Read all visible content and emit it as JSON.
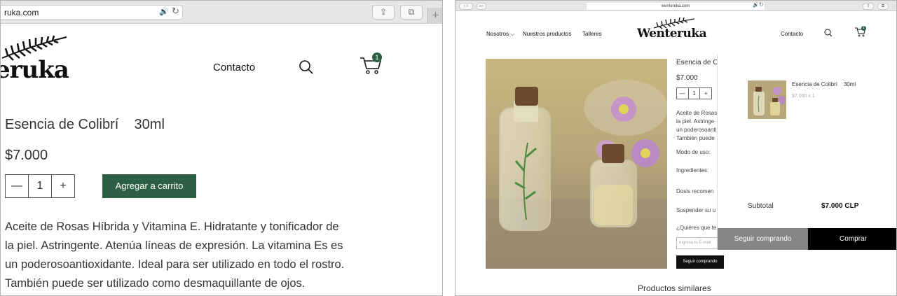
{
  "left": {
    "url": "ruka.com",
    "logo": "eruka",
    "nav": {
      "contact": "Contacto",
      "cart_count": "1"
    },
    "product": {
      "name": "Esencia de Colibrí    30ml",
      "price": "$7.000",
      "qty_minus": "—",
      "qty": "1",
      "qty_plus": "+",
      "add_to_cart": "Agregar a carrito",
      "description": [
        "Aceite de Rosas Híbrida y Vitamina E. Hidratante y tonificador de",
        "la piel. Astringente. Atenúa líneas de expresión. La vitamina Es es",
        "un poderosoantioxidante. Ideal para ser utilizado en todo el rostro.",
        "También puede ser utilizado como desmaquillante de ojos."
      ]
    }
  },
  "right": {
    "url": "wenteruka.com",
    "nav": {
      "nosotros": "Nosotros",
      "productos": "Nuestros productos",
      "talleres": "Talleres",
      "contact": "Contacto",
      "cart_count": "1"
    },
    "logo": "Wenteruka",
    "product": {
      "name": "Esencia de C",
      "price": "$7.000",
      "qty_minus": "—",
      "qty": "1",
      "qty_plus": "+",
      "desc_lines": [
        "Aceite de Rosas",
        "la piel. Astringe",
        "un poderosoanti",
        "También puede"
      ],
      "modo": "Modo de uso:",
      "ingredientes": "Ingredientes:",
      "dosis": "Dosis recomen",
      "suspender": "Suspender su u",
      "quieres": "¿Quiéres que te",
      "email_placeholder": "Ingresa tu E-mail",
      "subscribe": "Seguir comprando"
    },
    "similar": "Productos similares",
    "cart": {
      "item_name": "Esencia de Colibrí    30ml",
      "item_qty": "$7.000 x 1",
      "subtotal_label": "Subtotal",
      "subtotal_value": "$7.000 CLP",
      "continue": "Seguir comprando",
      "checkout": "Comprar"
    }
  },
  "colors": {
    "accent": "#2d5f43",
    "dark": "#000000",
    "gray_button": "#858585"
  }
}
